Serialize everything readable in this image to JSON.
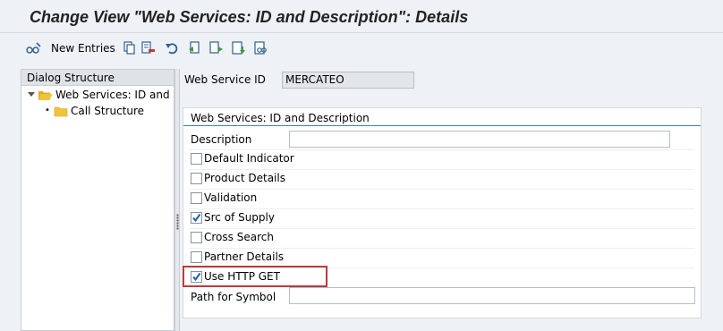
{
  "window": {
    "title": "Change View \"Web Services: ID and Description\": Details"
  },
  "toolbar": {
    "new_entries_label": "New Entries",
    "icons": [
      "glasses-edit-icon",
      "copy-icon",
      "delete-icon",
      "undo-icon",
      "previous-entry-icon",
      "next-entry-icon",
      "save-icon",
      "find-icon"
    ]
  },
  "dialog_structure": {
    "header": "Dialog Structure",
    "items": [
      {
        "label": "Web Services: ID and Description",
        "expanded": true,
        "level": 0
      },
      {
        "label": "Call Structure",
        "level": 1
      }
    ]
  },
  "details": {
    "web_service_id_label": "Web Service ID",
    "web_service_id_value": "MERCATEO",
    "group_title": "Web Services: ID and Description",
    "description_label": "Description",
    "description_value": "",
    "checkboxes": [
      {
        "label": "Default Indicator",
        "checked": false
      },
      {
        "label": "Product Details",
        "checked": false
      },
      {
        "label": "Validation",
        "checked": false
      },
      {
        "label": "Src of Supply",
        "checked": true
      },
      {
        "label": "Cross Search",
        "checked": false
      },
      {
        "label": "Partner Details",
        "checked": false
      },
      {
        "label": "Use HTTP GET",
        "checked": true
      }
    ],
    "path_label": "Path for Symbol",
    "path_value": ""
  },
  "colors": {
    "accent_line": "#3f7fc7",
    "highlight_border": "#c0393b",
    "folder": "#f2c23a",
    "checkmark": "#1f5fa8"
  }
}
